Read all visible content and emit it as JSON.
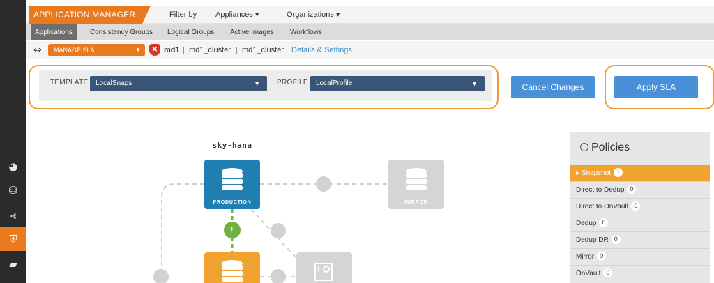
{
  "rail": {
    "icons": [
      "dashboard-icon",
      "database-icon",
      "chart-icon",
      "shield-icon",
      "book-icon"
    ]
  },
  "header": {
    "app_title": "APPLICATION MANAGER",
    "filter_label": "Filter by",
    "appliances": "Appliances ▾",
    "organizations": "Organizations ▾"
  },
  "tabs": [
    {
      "label": "Applications"
    },
    {
      "label": "Consistency Groups"
    },
    {
      "label": "Logical Groups"
    },
    {
      "label": "Active Images"
    },
    {
      "label": "Workflows"
    }
  ],
  "sla_bar": {
    "select_label": "MANAGE SLA",
    "app_name": "md1",
    "sep1": "|",
    "cluster1": "md1_cluster",
    "sep2": "|",
    "cluster2": "md1_cluster",
    "details_link": "Details & Settings"
  },
  "template": {
    "label": "TEMPLATE",
    "value": "LocalSnaps"
  },
  "profile": {
    "label": "PROFILE",
    "value": "LocalProfile"
  },
  "buttons": {
    "cancel": "Cancel Changes",
    "apply": "Apply SLA"
  },
  "diagram": {
    "host_name": "sky-hana",
    "production_label": "PRODUCTION",
    "mirror_label": "MIRROR",
    "connector_badge": "1",
    "colors": {
      "production": "#1f7fb0",
      "mirror": "#d5d5d5",
      "snapshot": "#f0a32e",
      "connector": "#6db33f"
    }
  },
  "policies": {
    "title": "Policies",
    "items": [
      {
        "label": "Snapshot",
        "count": "1",
        "active": true
      },
      {
        "label": "Direct to Dedup",
        "count": "0"
      },
      {
        "label": "Direct to OnVault",
        "count": "0"
      },
      {
        "label": "Dedup",
        "count": "0"
      },
      {
        "label": "Dedup DR",
        "count": "0"
      },
      {
        "label": "Mirror",
        "count": "0"
      },
      {
        "label": "OnVault",
        "count": "0"
      }
    ]
  }
}
